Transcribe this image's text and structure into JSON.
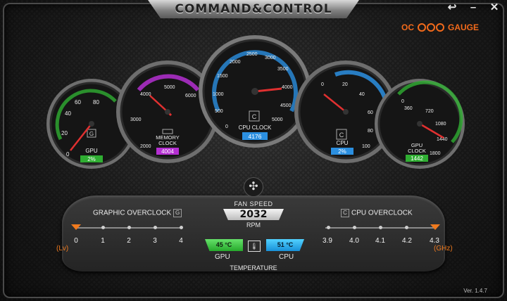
{
  "app": {
    "title": "COMMAND&CONTROL",
    "brand_prefix": "OC",
    "brand_suffix": "GAUGE",
    "version": "Ver. 1.4.7"
  },
  "window": {
    "back_label": "↩",
    "minimize_label": "–",
    "close_label": "✕"
  },
  "gauges": {
    "gpu": {
      "label": "GPU",
      "value": "2%",
      "badge": "G",
      "ticks": [
        "0",
        "20",
        "40",
        "60",
        "80"
      ],
      "accent": "#2fae32"
    },
    "memory": {
      "label_line1": "MEMORY",
      "label_line2": "CLOCK",
      "value": "4004",
      "ticks": [
        "2000",
        "3000",
        "4000",
        "5000",
        "6000"
      ],
      "accent": "#b42fd1"
    },
    "cpu_clock": {
      "label": "CPU CLOCK",
      "value": "4176",
      "badge": "C",
      "ticks": [
        "0",
        "500",
        "1000",
        "1500",
        "2000",
        "2500",
        "3000",
        "3500",
        "4000",
        "4500",
        "5000"
      ],
      "accent": "#2b8fe0"
    },
    "cpu": {
      "label": "CPU",
      "value": "2%",
      "badge": "C",
      "ticks": [
        "0",
        "20",
        "40",
        "60",
        "80",
        "100"
      ],
      "accent": "#2b8fe0"
    },
    "gpu_clock": {
      "label_line1": "GPU",
      "label_line2": "CLOCK",
      "value": "1442",
      "ticks": [
        "0",
        "360",
        "720",
        "1080",
        "1440",
        "1800"
      ],
      "accent": "#2fae32"
    }
  },
  "graphic_oc": {
    "title": "GRAPHIC OVERCLOCK",
    "icon": "G",
    "levels": [
      "0",
      "1",
      "2",
      "3",
      "4"
    ],
    "unit": "(Lv)"
  },
  "cpu_oc": {
    "title": "CPU OVERCLOCK",
    "icon": "C",
    "levels": [
      "3.9",
      "4.0",
      "4.1",
      "4.2",
      "4.3"
    ],
    "unit": "(GHz)"
  },
  "fan": {
    "title": "FAN SPEED",
    "value": "2032",
    "unit": "RPM"
  },
  "temperature": {
    "title": "TEMPERATURE",
    "gpu_label": "GPU",
    "gpu_value": "45 °C",
    "cpu_label": "CPU",
    "cpu_value": "51 °C"
  }
}
